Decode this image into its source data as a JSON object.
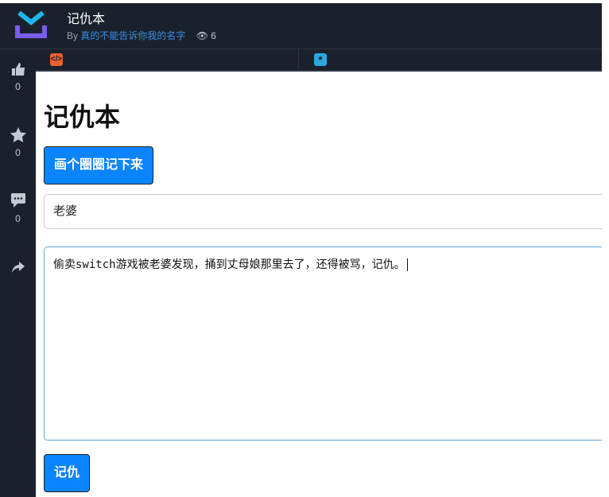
{
  "header": {
    "title": "记仇本",
    "by": "By",
    "author": "真的不能告诉你我的名字",
    "views": "6"
  },
  "sidebar": {
    "likes": "0",
    "stars": "0",
    "comments": "0"
  },
  "tabs": [
    {
      "icon": "</>"
    },
    {
      "icon": "*"
    }
  ],
  "main": {
    "heading": "记仇本",
    "draw_button": "画个圈圈记下来",
    "name_value": "老婆",
    "text_value": "偷卖switch游戏被老婆发现，捅到丈母娘那里去了，还得被骂，记仇。",
    "submit_button": "记仇"
  },
  "colors": {
    "dark": "#1b212c",
    "accent": "#0a84ff",
    "link": "#3a8ee6"
  }
}
